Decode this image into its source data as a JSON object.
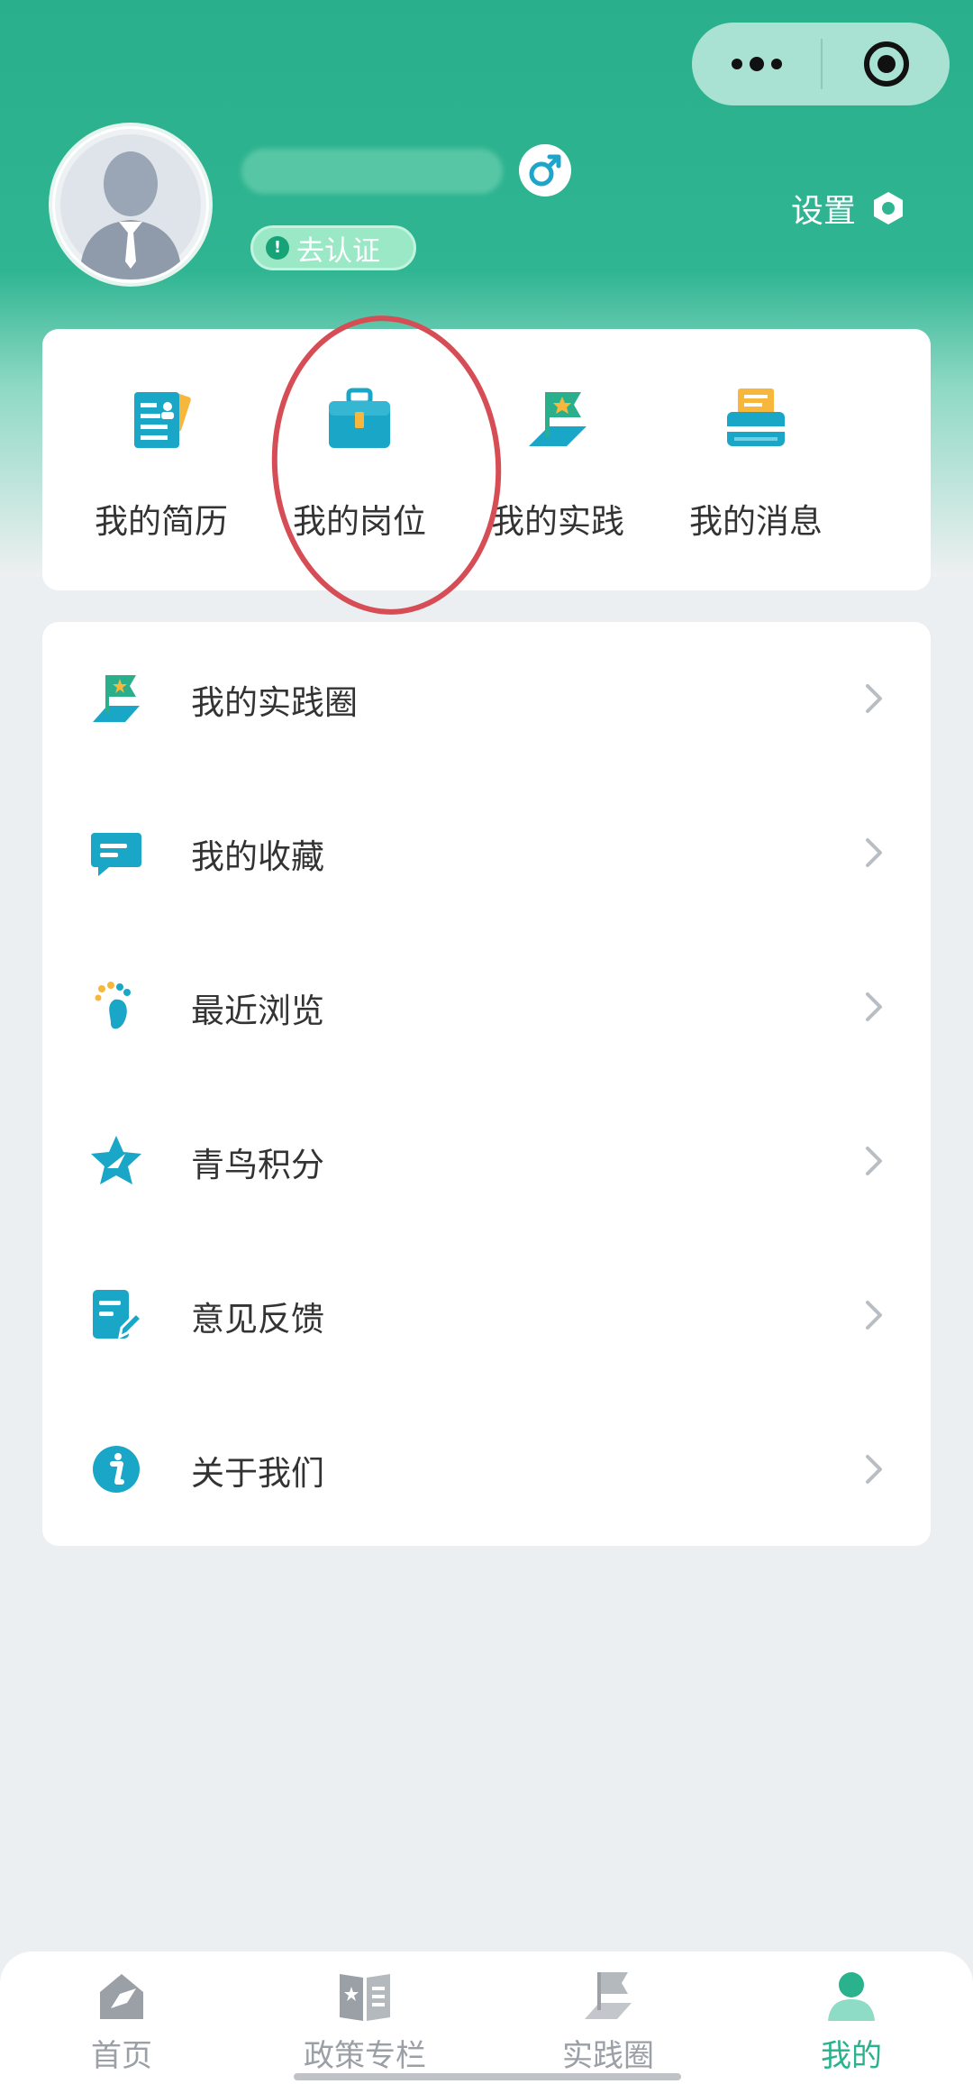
{
  "header": {
    "verify_label": "去认证",
    "settings_label": "设置",
    "gender": "male"
  },
  "quick_actions": [
    {
      "label": "我的简历",
      "icon": "resume-icon"
    },
    {
      "label": "我的岗位",
      "icon": "briefcase-icon"
    },
    {
      "label": "我的实践",
      "icon": "flag-icon"
    },
    {
      "label": "我的消息",
      "icon": "printer-message-icon"
    }
  ],
  "menu": [
    {
      "label": "我的实践圈",
      "icon": "flag-icon"
    },
    {
      "label": "我的收藏",
      "icon": "chat-bubble-icon"
    },
    {
      "label": "最近浏览",
      "icon": "footprint-icon"
    },
    {
      "label": "青鸟积分",
      "icon": "star-bird-icon"
    },
    {
      "label": "意见反馈",
      "icon": "feedback-edit-icon"
    },
    {
      "label": "关于我们",
      "icon": "info-icon"
    }
  ],
  "tabbar": [
    {
      "label": "首页",
      "icon": "home-icon",
      "active": false
    },
    {
      "label": "政策专栏",
      "icon": "book-icon",
      "active": false
    },
    {
      "label": "实践圈",
      "icon": "flag-icon",
      "active": false
    },
    {
      "label": "我的",
      "icon": "person-icon",
      "active": true
    }
  ],
  "colors": {
    "brand": "#2aaf8c",
    "accent_blue": "#1aa6c6",
    "highlight_circle": "#d64d55",
    "tab_active": "#29b28c"
  }
}
